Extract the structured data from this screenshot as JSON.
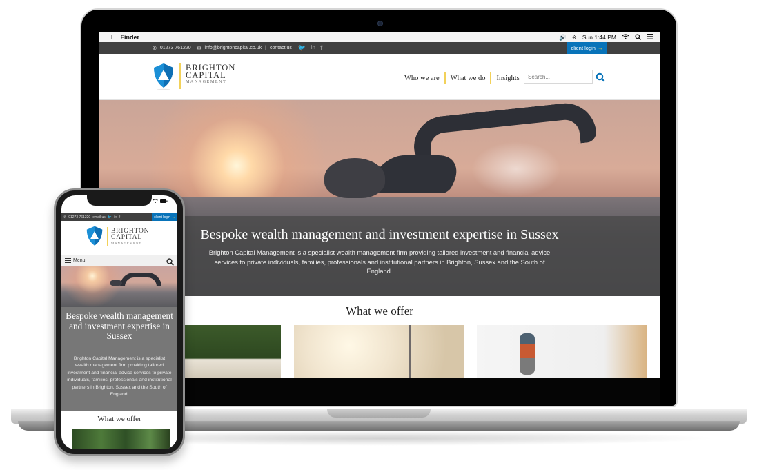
{
  "mac_menubar": {
    "app_name": "Finder",
    "clock": "Sun 1:44 PM",
    "icons": [
      "apple-icon",
      "volume-icon",
      "bluetooth-icon",
      "wifi-icon",
      "spotlight-search-icon",
      "notification-list-icon"
    ]
  },
  "site": {
    "topbar": {
      "phone": "01273 761220",
      "email": "info@brightoncapital.co.uk",
      "separator": "|",
      "contact_link": "contact us",
      "social": [
        "twitter-icon",
        "linkedin-icon",
        "facebook-icon"
      ],
      "client_login": "client login",
      "client_login_arrow": "→"
    },
    "logo": {
      "line1": "BRIGHTON",
      "line2": "CAPITAL",
      "line3": "MANAGEMENT"
    },
    "nav": {
      "items": [
        "Who we are",
        "What we do",
        "Insights"
      ],
      "search_placeholder": "Search..."
    },
    "hero": {
      "title": "Bespoke wealth management and investment expertise in Sussex",
      "description": "Brighton Capital Management is a specialist wealth management firm providing tailored investment and financial advice services to private individuals, families, professionals and institutional partners in Brighton, Sussex and the South of England."
    },
    "offer": {
      "title": "What we offer"
    }
  },
  "mobile": {
    "topbar": {
      "phone": "01273 761220",
      "email_link": "email us",
      "client_login": "client login",
      "client_login_arrow": "→"
    },
    "menu_label": "Menu",
    "hero_title": "Bespoke wealth management and investment expertise in Sussex",
    "hero_description": "Brighton Capital Management is a specialist wealth management firm providing tailored investment and financial advice services to private individuals, families, professionals and institutional partners in Brighton, Sussex and the South of England.",
    "offer_title": "What we offer"
  },
  "colors": {
    "brand_blue": "#0873b9",
    "accent_yellow": "#f2d15a",
    "topbar_grey": "#404040",
    "hero_overlay": "#464646"
  }
}
